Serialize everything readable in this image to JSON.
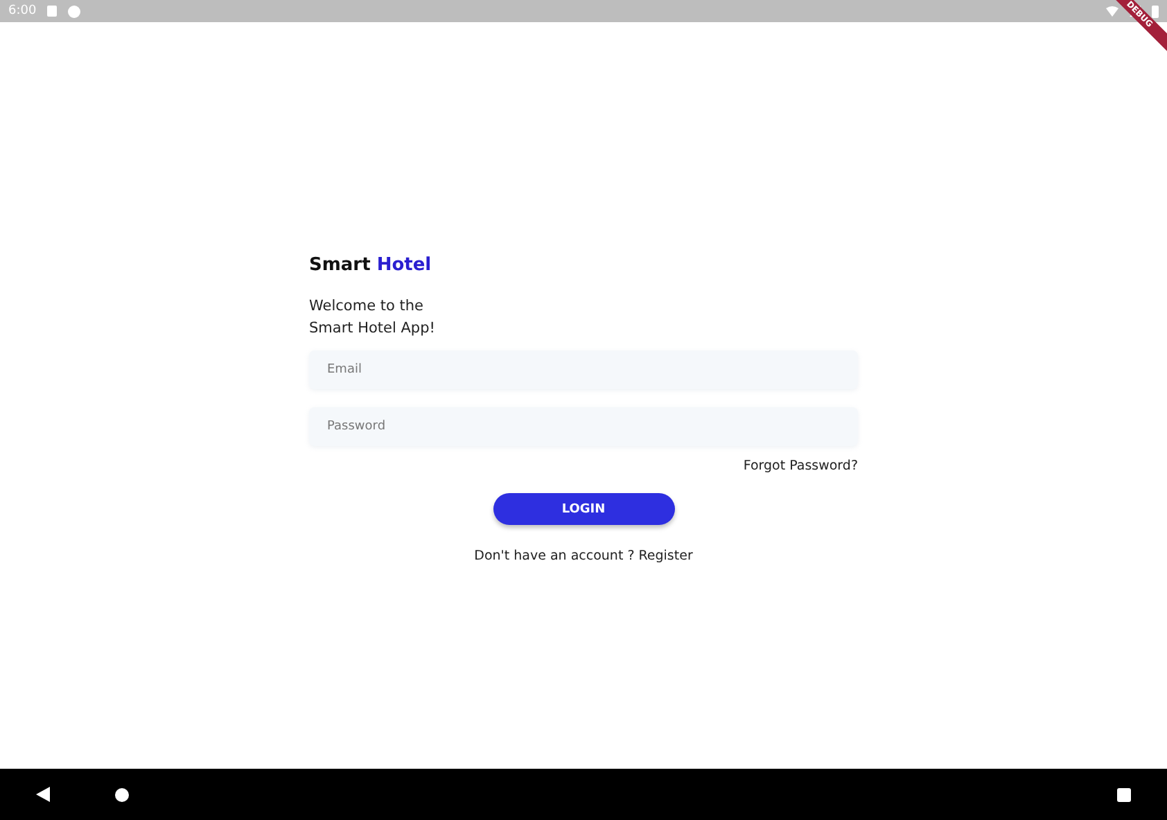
{
  "status_bar": {
    "time": "6:00"
  },
  "debug_banner": "DEBUG",
  "title": {
    "text": "Smart",
    "accent": "Hotel"
  },
  "welcome": [
    "Welcome to the",
    "Smart Hotel App!"
  ],
  "fields": [
    {
      "placeholder": "Email"
    },
    {
      "placeholder": "Password"
    }
  ],
  "forgot_link": "Forgot Password?",
  "login_button": "LOGIN",
  "register_prompt": {
    "text": "Don't have an account ?",
    "link": "Register"
  }
}
